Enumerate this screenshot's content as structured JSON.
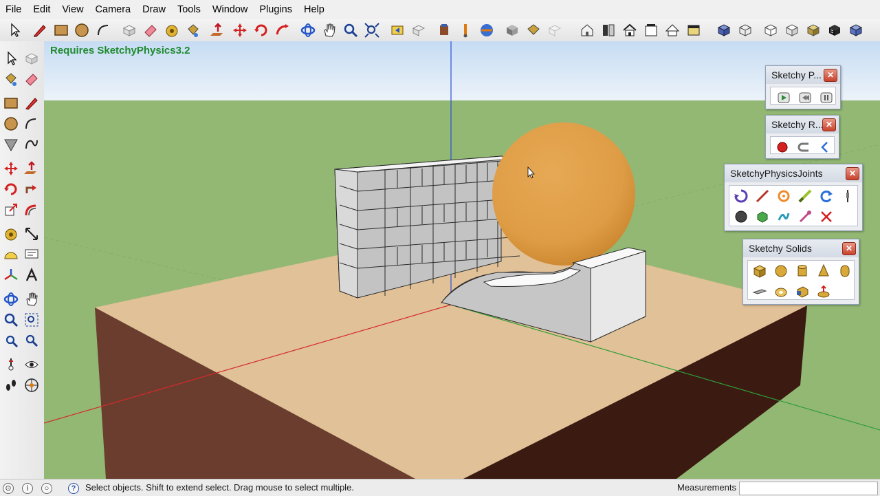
{
  "menu": [
    "File",
    "Edit",
    "View",
    "Camera",
    "Draw",
    "Tools",
    "Window",
    "Plugins",
    "Help"
  ],
  "viewport": {
    "note": "Requires SketchyPhysics3.2"
  },
  "panels": {
    "sketchy_physics": {
      "title": "Sketchy P..."
    },
    "sketchy_record": {
      "title": "Sketchy R..."
    },
    "joints": {
      "title": "SketchyPhysicsJoints"
    },
    "solids": {
      "title": "Sketchy Solids"
    }
  },
  "status": {
    "text": "Select objects. Shift to extend select. Drag mouse to select multiple.",
    "measurements_label": "Measurements",
    "measurements_value": ""
  },
  "colors": {
    "sky_top": "#cfe1f5",
    "ground": "#93b874",
    "table_top": "#e1c197",
    "table_side": "#6b3d2f",
    "sphere": "#e2a14a",
    "axis_red": "#d42a2a",
    "axis_green": "#2e9e3a",
    "axis_blue": "#2a4fd4"
  }
}
